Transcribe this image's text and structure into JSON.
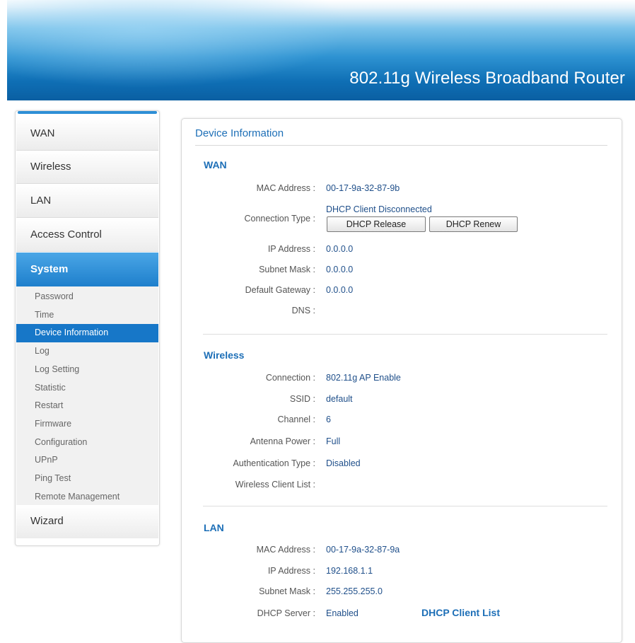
{
  "header": {
    "title": "802.11g Wireless Broadband Router"
  },
  "sidebar": {
    "tabs": [
      "WAN",
      "Wireless",
      "LAN",
      "Access Control",
      "System",
      "Wizard"
    ],
    "active_tab": "System",
    "system_items": [
      "Password",
      "Time",
      "Device Information",
      "Log",
      "Log Setting",
      "Statistic",
      "Restart",
      "Firmware",
      "Configuration",
      "UPnP",
      "Ping Test",
      "Remote Management"
    ],
    "active_item": "Device Information"
  },
  "main": {
    "title": "Device Information",
    "wan": {
      "heading": "WAN",
      "mac_label": "MAC Address :",
      "mac_value": "00-17-9a-32-87-9b",
      "conn_label": "Connection Type :",
      "conn_value": "DHCP Client Disconnected",
      "release_button": "DHCP Release",
      "renew_button": "DHCP Renew",
      "ip_label": "IP Address :",
      "ip_value": "0.0.0.0",
      "mask_label": "Subnet Mask :",
      "mask_value": "0.0.0.0",
      "gw_label": "Default Gateway :",
      "gw_value": "0.0.0.0",
      "dns_label": "DNS :",
      "dns_value": ""
    },
    "wireless": {
      "heading": "Wireless",
      "conn_label": "Connection :",
      "conn_value": "802.11g AP Enable",
      "ssid_label": "SSID :",
      "ssid_value": "default",
      "channel_label": "Channel :",
      "channel_value": "6",
      "antenna_label": "Antenna Power :",
      "antenna_value": "Full",
      "auth_label": "Authentication Type :",
      "auth_value": "Disabled",
      "clients_label": "Wireless Client List :",
      "clients_value": ""
    },
    "lan": {
      "heading": "LAN",
      "mac_label": "MAC Address :",
      "mac_value": "00-17-9a-32-87-9a",
      "ip_label": "IP Address :",
      "ip_value": "192.168.1.1",
      "mask_label": "Subnet Mask :",
      "mask_value": "255.255.255.0",
      "dhcp_label": "DHCP Server :",
      "dhcp_value": "Enabled",
      "dhcp_client_link": "DHCP Client List"
    }
  }
}
